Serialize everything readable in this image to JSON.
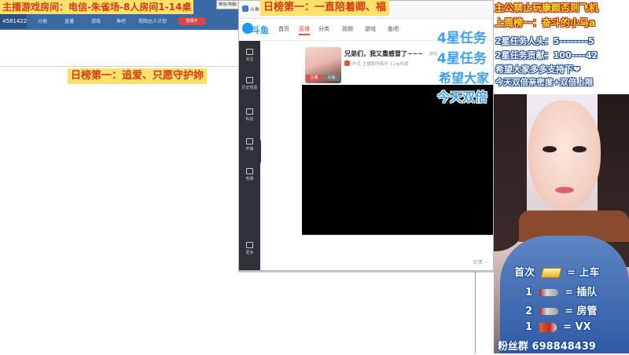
{
  "left_window": {
    "room_id": "4581422",
    "nav_items": [
      "分类",
      "直播",
      "游戏",
      "鱼吧",
      "视频达人计划"
    ],
    "red_button": "直播中",
    "mini_window_label": "微信(电脑)"
  },
  "overlay": {
    "room_banner": "主播游戏房间：电信-朱雀场-8人房间1-14桌",
    "daily_rank_left": "日榜第一：追爱、只愿守护妳",
    "daily_rank_mid": "日榜第一：一直陪着卿、福",
    "blue_lines": [
      "4星任务",
      "4星任务",
      "希望大家",
      "今天双倍"
    ],
    "right_lines": [
      "主公禁止玩康颜否则飞机",
      "上周榜一：奋斗的小马a",
      "2星任务人头：5--------5",
      "2星任务贡献：100----42",
      "希望大家多多支持下❤",
      "今天双倍亲密度+双倍上限"
    ],
    "pass_rows": [
      {
        "count": "首次",
        "gift": "gold-bar-icon",
        "eq": "=",
        "reward": "上车"
      },
      {
        "count": "1",
        "gift": "rocket-icon",
        "eq": "=",
        "reward": "插队"
      },
      {
        "count": "2",
        "gift": "rocket-icon",
        "eq": "=",
        "reward": "房管"
      },
      {
        "count": "1",
        "gift": "big-rocket-icon",
        "eq": "=",
        "reward": "VX"
      }
    ],
    "fan_group": "粉丝群 698848439"
  },
  "browser": {
    "app_name": "斗鱼",
    "logo_text": "斗鱼",
    "nav": [
      "首页",
      "直播",
      "分类",
      "视频",
      "游戏",
      "鱼吧"
    ],
    "active_nav": "直播",
    "sidebar": [
      "关注",
      "历史观看",
      "私信",
      "开播",
      "竞赛",
      "更多"
    ],
    "stream_title": "兄弟们，我又重感冒了~~~",
    "stream_category": "游戏",
    "stream_meta": "扑克   主播暂时离开   1.2w热度",
    "avatar_tags": [
      "主播",
      "公会"
    ],
    "video_footer": "反馈  ···"
  }
}
